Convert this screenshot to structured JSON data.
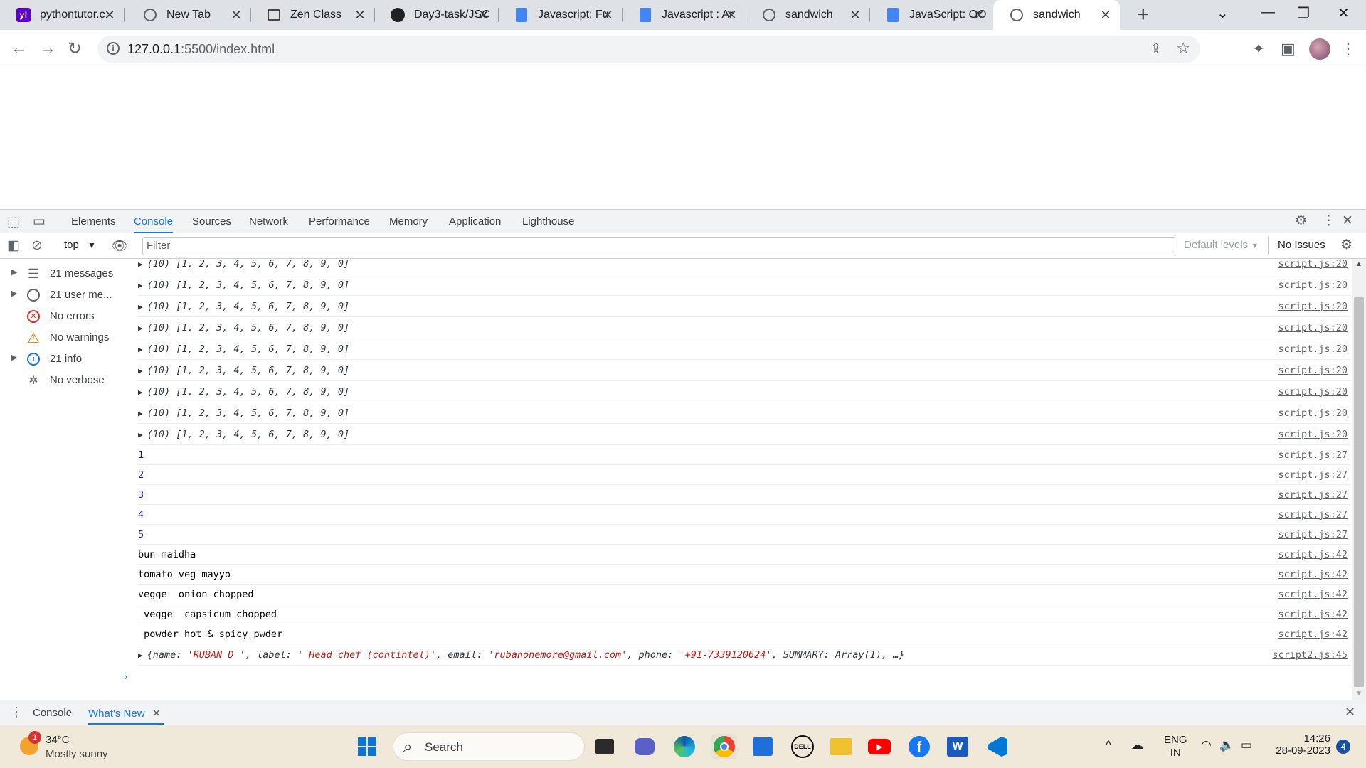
{
  "tabs": [
    {
      "title": "pythontutor.c",
      "favicon": "yahoo-icon"
    },
    {
      "title": "New Tab",
      "favicon": "globe-icon"
    },
    {
      "title": "Zen Class",
      "favicon": "zen-icon"
    },
    {
      "title": "Day3-task/JSC",
      "favicon": "github-icon"
    },
    {
      "title": "Javascript: Fu",
      "favicon": "docs-icon"
    },
    {
      "title": "Javascript : Ar",
      "favicon": "docs-icon"
    },
    {
      "title": "sandwich",
      "favicon": "globe-icon"
    },
    {
      "title": "JavaScript: OO",
      "favicon": "docs-icon"
    },
    {
      "title": "sandwich",
      "favicon": "globe-icon",
      "active": true
    }
  ],
  "address": {
    "host": "127.0.0.1",
    "path": ":5500/index.html"
  },
  "devtools": {
    "tabs": [
      "Elements",
      "Console",
      "Sources",
      "Network",
      "Performance",
      "Memory",
      "Application",
      "Lighthouse"
    ],
    "active_tab": "Console",
    "context": "top",
    "filter_placeholder": "Filter",
    "levels": "Default levels",
    "issues": "No Issues"
  },
  "sidebar": [
    {
      "label": "21 messages",
      "icon": "list-icon",
      "expandable": true
    },
    {
      "label": "21 user me...",
      "icon": "user-icon",
      "expandable": true
    },
    {
      "label": "No errors",
      "icon": "error-icon",
      "expandable": false
    },
    {
      "label": "No warnings",
      "icon": "warning-icon",
      "expandable": false
    },
    {
      "label": "21 info",
      "icon": "info-icon",
      "expandable": true
    },
    {
      "label": "No verbose",
      "icon": "bug-icon",
      "expandable": false
    }
  ],
  "console": {
    "array_prefix": "(10)",
    "array_values": "[1, 2, 3, 4, 5, 6, 7, 8, 9, 0]",
    "array_source": "script.js:20",
    "array_count": 9,
    "numbers": [
      "1",
      "2",
      "3",
      "4",
      "5"
    ],
    "numbers_source": "script.js:27",
    "strings": [
      "bun maidha",
      "tomato veg mayyo",
      "vegge  onion chopped",
      " vegge  capsicum chopped",
      " powder hot & spicy pwder"
    ],
    "strings_source": "script.js:42",
    "object": {
      "name": "'RUBAN D '",
      "label": "' Head chef (contintel)'",
      "email": "'rubanonemore@gmail.com'",
      "phone": "'+91-7339120624'",
      "summary": "Array(1)",
      "source": "script2.js:45"
    }
  },
  "drawer": {
    "tabs": [
      "Console",
      "What's New"
    ],
    "active": "What's New"
  },
  "taskbar": {
    "weather_temp": "34°C",
    "weather_desc": "Mostly sunny",
    "weather_badge": "1",
    "search_label": "Search",
    "lang_top": "ENG",
    "lang_bottom": "IN",
    "time": "14:26",
    "date": "28-09-2023",
    "notif_count": "4"
  }
}
